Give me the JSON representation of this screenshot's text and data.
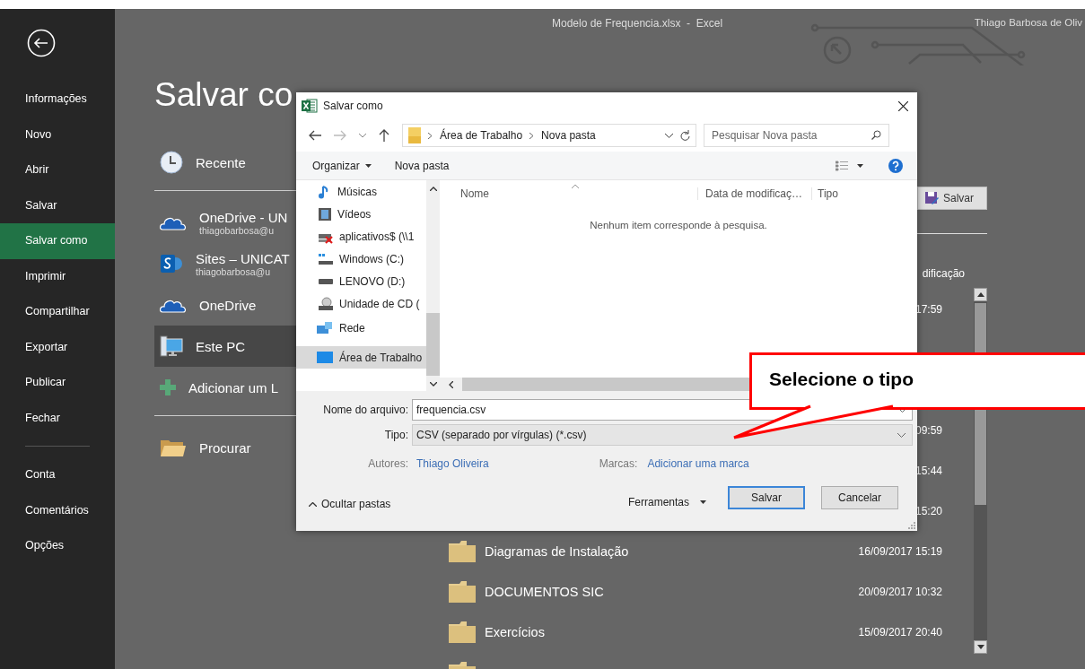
{
  "window": {
    "title": "Modelo de Frequencia.xlsx  -  Excel",
    "user": "Thiago Barbosa de Oliv"
  },
  "sidebar": {
    "items": [
      {
        "label": "Informações",
        "selected": false
      },
      {
        "label": "Novo",
        "selected": false
      },
      {
        "label": "Abrir",
        "selected": false
      },
      {
        "label": "Salvar",
        "selected": false
      },
      {
        "label": "Salvar como",
        "selected": true
      },
      {
        "label": "Imprimir",
        "selected": false
      },
      {
        "label": "Compartilhar",
        "selected": false
      },
      {
        "label": "Exportar",
        "selected": false
      },
      {
        "label": "Publicar",
        "selected": false
      },
      {
        "label": "Fechar",
        "selected": false
      }
    ],
    "bottom_items": [
      {
        "label": "Conta",
        "selected": false
      },
      {
        "label": "Comentários",
        "selected": false
      },
      {
        "label": "Opções",
        "selected": false
      }
    ]
  },
  "page": {
    "heading": "Salvar co",
    "locations": [
      {
        "kind": "recent",
        "label": "Recente",
        "selected": false
      },
      {
        "kind": "onedrive",
        "label": "OneDrive - UN",
        "sub": "thiagobarbosa@u",
        "selected": false
      },
      {
        "kind": "sharepoint",
        "label": "Sites – UNICAT",
        "sub": "thiagobarbosa@u",
        "selected": false
      },
      {
        "kind": "onedrive",
        "label": "OneDrive",
        "selected": false
      },
      {
        "kind": "pc",
        "label": "Este PC",
        "selected": true
      },
      {
        "kind": "add",
        "label": "Adicionar um L",
        "selected": false
      },
      {
        "kind": "browse",
        "label": "Procurar",
        "selected": false
      }
    ],
    "save_button": "Salvar",
    "column_header": "dificação",
    "rows": [
      {
        "modified": "17:59"
      },
      {
        "kind": "blank"
      },
      {
        "kind": "blank"
      },
      {
        "modified": "09:59"
      },
      {
        "modified": "15:44"
      },
      {
        "modified": "15:20"
      },
      {
        "kind": "folder",
        "name": "Diagramas de Instalação",
        "modified": "16/09/2017 15:19"
      },
      {
        "kind": "folder",
        "name": "DOCUMENTOS SIC",
        "modified": "20/09/2017 10:32"
      },
      {
        "kind": "folder",
        "name": "Exercícios",
        "modified": "15/09/2017 20:40"
      },
      {
        "kind": "folder"
      }
    ]
  },
  "dialog": {
    "title": "Salvar como",
    "path": [
      "Área de Trabalho",
      "Nova pasta"
    ],
    "search": {
      "placeholder": "Pesquisar Nova pasta"
    },
    "organize": "Organizar",
    "new_folder": "Nova pasta",
    "nav_items": [
      {
        "kind": "music",
        "label": "Músicas",
        "selected": false
      },
      {
        "kind": "video",
        "label": "Vídeos",
        "selected": false
      },
      {
        "kind": "netdrive",
        "label": "aplicativos$ (\\\\1",
        "selected": false
      },
      {
        "kind": "windrive",
        "label": "Windows (C:)",
        "selected": false
      },
      {
        "kind": "drive",
        "label": "LENOVO (D:)",
        "selected": false
      },
      {
        "kind": "cd",
        "label": "Unidade de CD (",
        "selected": false
      },
      {
        "kind": "network",
        "label": "Rede",
        "selected": false
      },
      {
        "kind": "desktop",
        "label": "Área de Trabalho",
        "selected": true
      }
    ],
    "columns": [
      "Nome",
      "Data de modificaç…",
      "Tipo"
    ],
    "empty_message": "Nenhum item corresponde à pesquisa.",
    "filename_label": "Nome do arquivo:",
    "filename": "frequencia.csv",
    "type_label": "Tipo:",
    "type": "CSV (separado por vírgulas) (*.csv)",
    "authors_label": "Autores:",
    "authors": "Thiago Oliveira",
    "tags_label": "Marcas:",
    "tags": "Adicionar uma marca",
    "hide_folders": "Ocultar pastas",
    "tools": "Ferramentas",
    "buttons": [
      {
        "label": "Salvar",
        "default": true
      },
      {
        "label": "Cancelar",
        "default": false
      }
    ]
  },
  "callout": "Selecione o tipo"
}
